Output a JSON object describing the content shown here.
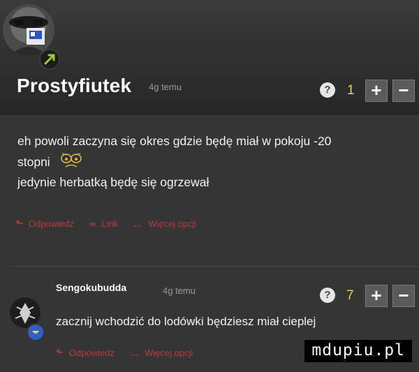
{
  "comments": [
    {
      "username": "Prostyfiutek",
      "time": "4g temu",
      "help": "?",
      "score": "1",
      "upvote": "+",
      "downvote": "−",
      "lines": [
        "eh powoli zaczyna się okres gdzie będę miał w pokoju -20",
        "stopni",
        "jedynie herbatką będę się ogrzewał"
      ],
      "actions": {
        "reply": "Odpowiedz",
        "link": "Link",
        "more": "Więcej opcji"
      }
    },
    {
      "username": "Sengokubudda",
      "time": "4g temu",
      "help": "?",
      "score": "7",
      "upvote": "+",
      "downvote": "−",
      "lines": [
        "zacznij wchodzić do lodówki będziesz miał cieplej"
      ],
      "actions": {
        "reply": "Odpowiedz",
        "more": "Więcej opcji"
      }
    }
  ],
  "watermark": "mdupiu.pl",
  "colors": {
    "background": "#353535",
    "score": "#e4d84a",
    "action": "#b83a3a",
    "badge": "#2a62c8"
  },
  "icons": [
    "reply-arrow-icon",
    "link-icon",
    "ellipsis-icon",
    "help-icon",
    "plus-icon",
    "minus-icon",
    "rank-badge-icon"
  ]
}
